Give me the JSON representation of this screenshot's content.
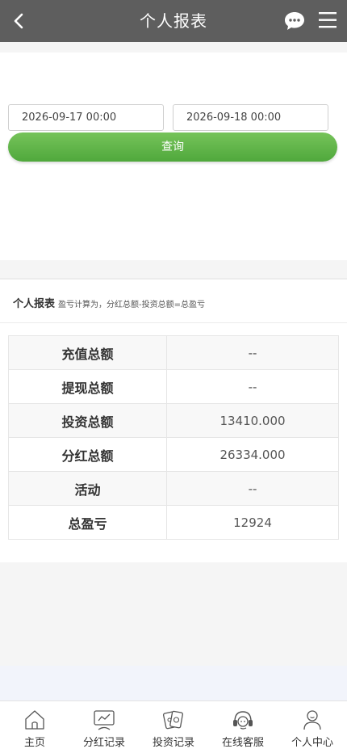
{
  "header": {
    "title": "个人报表"
  },
  "query": {
    "start_date": "2026-09-17 00:00",
    "end_date": "2026-09-18 00:00",
    "button_label": "查询"
  },
  "report": {
    "heading": "个人报表",
    "note": "盈亏计算为，分红总额-投资总额=总盈亏",
    "rows": [
      {
        "label": "充值总额",
        "value": "--"
      },
      {
        "label": "提现总额",
        "value": "--"
      },
      {
        "label": "投资总额",
        "value": "13410.000"
      },
      {
        "label": "分红总额",
        "value": "26334.000"
      },
      {
        "label": "活动",
        "value": "--"
      },
      {
        "label": "总盈亏",
        "value": "12924"
      }
    ]
  },
  "tabbar": {
    "items": [
      {
        "label": "主页",
        "icon": "home-icon"
      },
      {
        "label": "分红记录",
        "icon": "monitor-chart-icon"
      },
      {
        "label": "投资记录",
        "icon": "cards-icon"
      },
      {
        "label": "在线客服",
        "icon": "headset-icon"
      },
      {
        "label": "个人中心",
        "icon": "user-icon"
      }
    ]
  },
  "colors": {
    "header_bg": "#5e5e5e",
    "button_green": "#5db447",
    "page_bg": "#f5f5f5"
  }
}
